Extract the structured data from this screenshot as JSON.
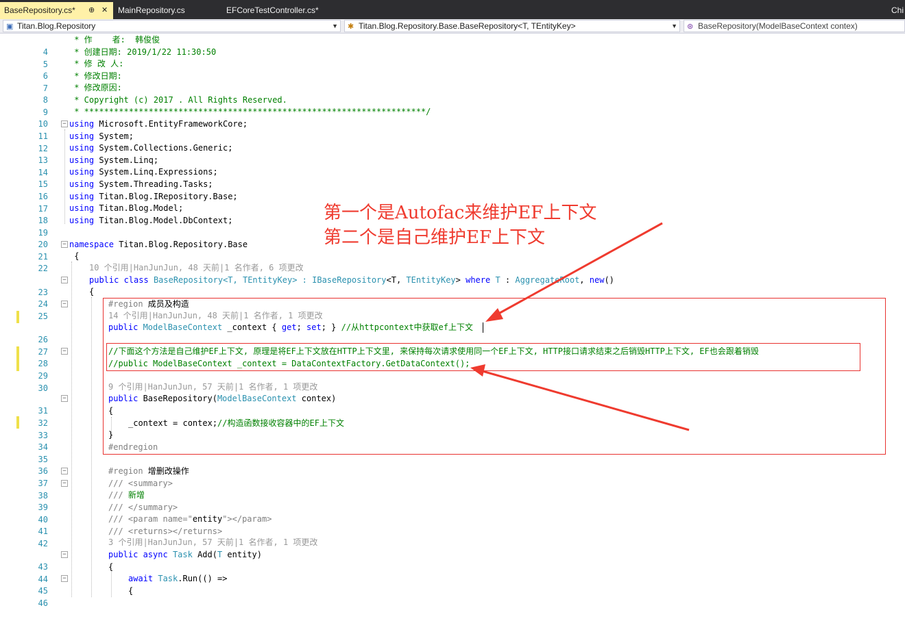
{
  "tabs": {
    "t1": "BaseRepository.cs*",
    "t1_pin": "⊕",
    "t1_close": "✕",
    "t2": "MainRepository.cs",
    "t3": "EFCoreTestController.cs*",
    "overflow": "Chi"
  },
  "nav": {
    "project": "Titan.Blog.Repository",
    "type": "Titan.Blog.Repository.Base.BaseRepository<T, TEntityKey>",
    "member": "BaseRepository(ModelBaseContext contex)"
  },
  "lines": {
    "n4": "4",
    "n5": "5",
    "n6": "6",
    "n7": "7",
    "n8": "8",
    "n9": "9",
    "n10": "10",
    "n11": "11",
    "n12": "12",
    "n13": "13",
    "n14": "14",
    "n15": "15",
    "n16": "16",
    "n17": "17",
    "n18": "18",
    "n19": "19",
    "n20": "20",
    "n21": "21",
    "n22": "22",
    "n23": "23",
    "n24": "24",
    "n25": "25",
    "n26": "26",
    "n27": "27",
    "n28": "28",
    "n29": "29",
    "n30": "30",
    "n31": "31",
    "n32": "32",
    "n33": "33",
    "n34": "34",
    "n35": "35",
    "n36": "36",
    "n37": "37",
    "n38": "38",
    "n39": "39",
    "n40": "40",
    "n41": "41",
    "n42": "42",
    "n43": "43",
    "n44": "44",
    "n45": "45",
    "n46": "46"
  },
  "code": {
    "l4": " * 作    者:  韩俊俊",
    "l5": " * 创建日期: 2019/1/22 11:30:50",
    "l6": " * 修 改 人:",
    "l7": " * 修改日期:",
    "l8": " * 修改原因:",
    "l9": " * Copyright (c) 2017 . All Rights Reserved.",
    "l10": " * *********************************************************************/",
    "using": "using",
    "l11": " Microsoft.EntityFrameworkCore;",
    "l12": " System;",
    "l13": " System.Collections.Generic;",
    "l14": " System.Linq;",
    "l15": " System.Linq.Expressions;",
    "l16": " System.Threading.Tasks;",
    "l17": " Titan.Blog.IRepository.Base;",
    "l18": " Titan.Blog.Model;",
    "l19": " Titan.Blog.Model.DbContext;",
    "namespace": "namespace",
    "l21": " Titan.Blog.Repository.Base",
    "l22": " {",
    "lens23": "10 个引用|HanJunJun, 48 天前|1 名作者, 6 项更改",
    "l23_public": "public",
    "l23_class": " class ",
    "l23_name": "BaseRepository<T, TEntityKey> : ",
    "l23_iface": "IBaseRepository",
    "l23_generic": "<T, ",
    "l23_tkey": "TEntityKey",
    "l23_gt": "> ",
    "l23_where": "where",
    "l23_t": " T",
    "l23_colon": " : ",
    "l23_agg": "AggregateRoot",
    "l23_comma": ", ",
    "l23_new": "new",
    "l23_end": "()",
    "l24": "{",
    "l25_region": "#region",
    "l25_text": " 成员及构造",
    "lens26": "14 个引用|HanJunJun, 48 天前|1 名作者, 1 项更改",
    "l26_public": "public",
    "l26_type": " ModelBaseContext",
    "l26_rest": " _context { ",
    "l26_get": "get",
    "l26_semi1": "; ",
    "l26_set": "set",
    "l26_end": "; } ",
    "l26_comment": "//从httpcontext中获取ef上下文",
    "l28": "//下面这个方法是自己维护EF上下文, 原理是将EF上下文放在HTTP上下文里, 来保持每次请求使用同一个EF上下文, HTTP接口请求结束之后销毁HTTP上下文, EF也会跟着销毁",
    "l29": "//public ModelBaseContext _context = DataContextFactory.GetDataContext();",
    "lens31": "9 个引用|HanJunJun, 57 天前|1 名作者, 1 项更改",
    "l31_public": "public",
    "l31_name": " BaseRepository(",
    "l31_type": "ModelBaseContext",
    "l31_end": " contex)",
    "l32": "{",
    "l33_code": "_context = contex;",
    "l33_comment": "//构造函数接收容器中的EF上下文",
    "l34": "}",
    "l35": "#endregion",
    "l37_region": "#region",
    "l37_text": " 增删改操作",
    "l38_a": "/// ",
    "l38_b": "<summary>",
    "l39_a": "/// ",
    "l39_b": "新增",
    "l40_a": "/// ",
    "l40_b": "</summary>",
    "l41_a": "/// ",
    "l41_b": "<param name=\"",
    "l41_c": "entity",
    "l41_d": "\"></param>",
    "l42_a": "/// ",
    "l42_b": "<returns></returns>",
    "lens43": "3 个引用|HanJunJun, 57 天前|1 名作者, 1 项更改",
    "l43_public": "public",
    "l43_async": " async ",
    "l43_task": "Task",
    "l43_name": " Add(",
    "l43_t": "T",
    "l43_end": " entity)",
    "l44": "{",
    "l45_await": "await",
    "l45_task": " Task",
    "l45_rest": ".Run(() =>",
    "l46": "{"
  },
  "annotation": {
    "line1": "第一个是Autofac来维护EF上下文",
    "line2": "第二个是自己维护EF上下文"
  },
  "colors": {
    "keyword": "#0000ff",
    "type": "#2b91af",
    "comment": "#008000",
    "annotation_red": "#ef3b2f"
  }
}
